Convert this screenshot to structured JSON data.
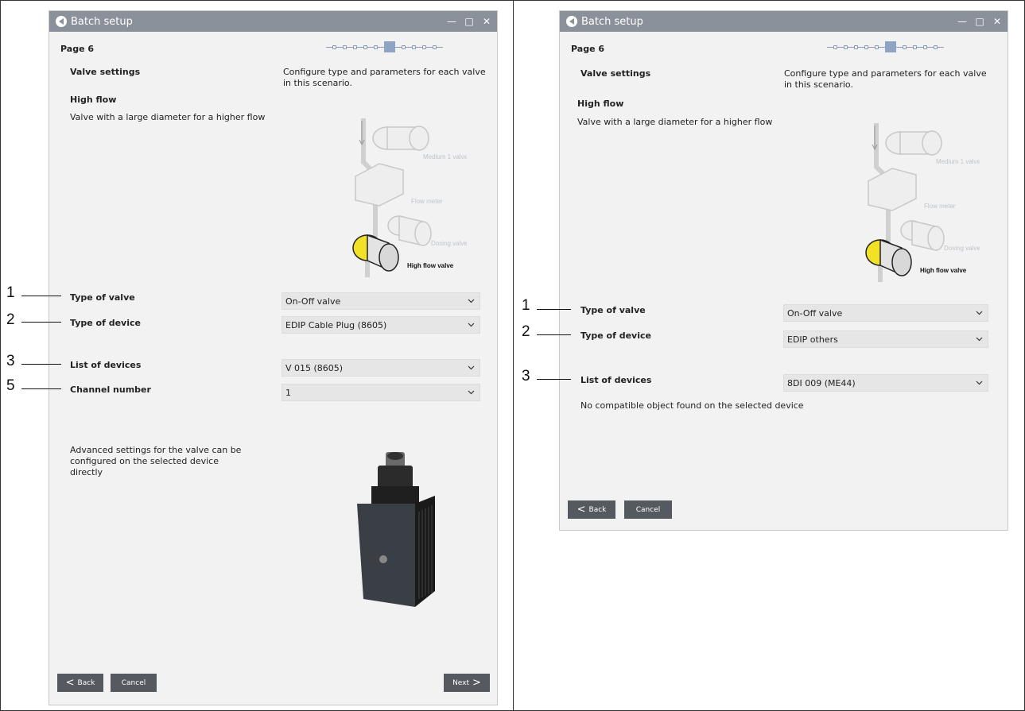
{
  "left": {
    "window_title": "Batch setup",
    "page": "Page 6",
    "section_title": "Valve settings",
    "section_desc": "Configure type and parameters for each valve in this scenario.",
    "valve_name": "High flow",
    "valve_desc": "Valve with a large diameter for a higher flow",
    "diagram": {
      "medium": "Medium 1 valve",
      "flow": "Flow meter",
      "dosing": "Dosing valve",
      "high": "High flow valve"
    },
    "fields": [
      {
        "callout": "1",
        "label": "Type of valve",
        "value": "On-Off valve"
      },
      {
        "callout": "2",
        "label": "Type of device",
        "value": "EDIP Cable Plug (8605)"
      },
      {
        "callout": "3",
        "label": "List of devices",
        "value": "V 015 (8605)"
      },
      {
        "callout": "5",
        "label": "Channel number",
        "value": "1"
      }
    ],
    "advanced_note": "Advanced settings for the valve can be configured on the selected device directly",
    "back": "Back",
    "cancel": "Cancel",
    "next": "Next"
  },
  "right": {
    "window_title": "Batch setup",
    "page": "Page 6",
    "section_title": "Valve settings",
    "section_desc": "Configure type and parameters for each valve in this scenario.",
    "valve_name": "High flow",
    "valve_desc": "Valve with a large diameter for a higher flow",
    "diagram": {
      "medium": "Medium 1 valve",
      "flow": "Flow meter",
      "dosing": "Dosing valve",
      "high": "High flow valve"
    },
    "fields": [
      {
        "callout": "1",
        "label": "Type of valve",
        "value": "On-Off valve"
      },
      {
        "callout": "2",
        "label": "Type of device",
        "value": "EDIP others"
      },
      {
        "callout": "3",
        "label": "List of devices",
        "value": "8DI 009 (ME44)"
      }
    ],
    "warning": "No compatible object found on the selected device",
    "back": "Back",
    "cancel": "Cancel"
  },
  "colors": {
    "titlebar": "#8a919b",
    "button": "#555a60",
    "highlight": "#f2e227",
    "stepper": "#8fa3c2"
  }
}
